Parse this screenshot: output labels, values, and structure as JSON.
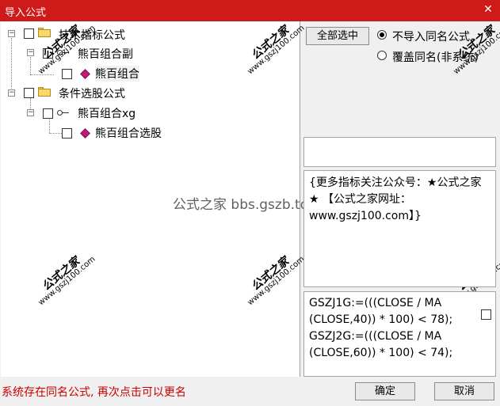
{
  "window": {
    "title": "导入公式",
    "close_glyph": "✕"
  },
  "tree": {
    "nodes": [
      {
        "label": "技术指标公式"
      },
      {
        "label": "熊百组合副"
      },
      {
        "label": "熊百组合"
      },
      {
        "label": "条件选股公式"
      },
      {
        "label": "熊百组合xg"
      },
      {
        "label": "熊百组合选股"
      }
    ]
  },
  "watermark": {
    "stamp_text": "公式之家",
    "stamp_url": "www.gszj100.com",
    "center_text": "公式之家 bbs.gszb.top"
  },
  "options": {
    "select_all_label": "全部选中",
    "radio_no_import_label": "不导入同名公式",
    "radio_overwrite_label": "覆盖同名(非系统)",
    "selected_radio": "不导入同名公式"
  },
  "description": {
    "text": "{更多指标关注公众号：★公式之家★ 【公式之家网址：www.gszj100.com】}"
  },
  "code": {
    "lines": [
      "GSZJ1G:=(((CLOSE / MA",
      "(CLOSE,40)) * 100) < 78);",
      "GSZJ2G:=(((CLOSE / MA",
      "(CLOSE,60)) * 100) < 74);"
    ]
  },
  "footer": {
    "status_text": "系统存在同名公式, 再次点击可以更名",
    "ok_label": "确定",
    "cancel_label": "取消"
  },
  "colors": {
    "titlebar": "#cf1a1a",
    "status_text": "#cc0000",
    "gem": "#c2187a",
    "folder": "#f6d86b"
  },
  "icons": [
    "folder-icon",
    "gem-icon",
    "key-icon",
    "close-icon"
  ]
}
